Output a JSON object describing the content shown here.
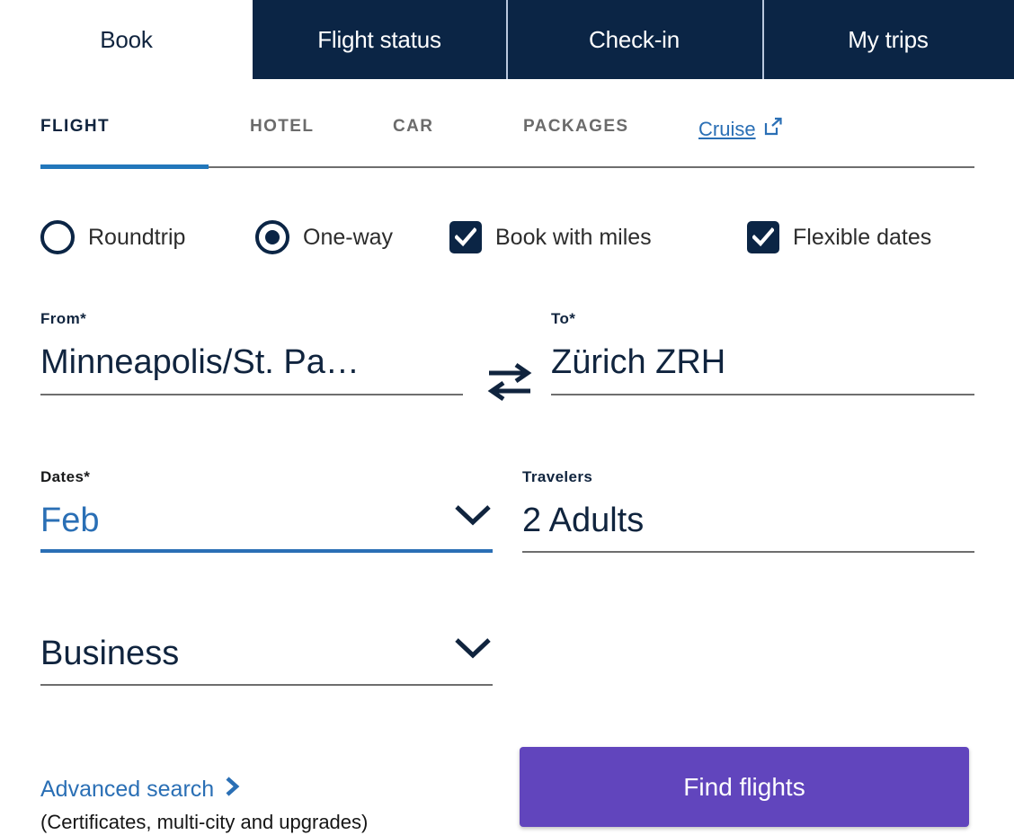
{
  "colors": {
    "navy": "#0b2545",
    "link_blue": "#2a6fb5",
    "accent_blue": "#2277bb",
    "button_purple": "#6145bd",
    "rule_gray": "#6e6e6e"
  },
  "topnav": {
    "tabs": [
      {
        "label": "Book",
        "active": true
      },
      {
        "label": "Flight status",
        "active": false
      },
      {
        "label": "Check-in",
        "active": false
      },
      {
        "label": "My trips",
        "active": false
      }
    ]
  },
  "subtabs": {
    "items": [
      {
        "label": "FLIGHT",
        "active": true
      },
      {
        "label": "HOTEL",
        "active": false
      },
      {
        "label": "CAR",
        "active": false
      },
      {
        "label": "PACKAGES",
        "active": false
      }
    ],
    "cruise": {
      "label": "Cruise",
      "icon": "external-link-icon"
    }
  },
  "trip_options": {
    "roundtrip": {
      "label": "Roundtrip",
      "selected": false
    },
    "oneway": {
      "label": "One-way",
      "selected": true
    },
    "book_with_miles": {
      "label": "Book with miles",
      "checked": true
    },
    "flexible_dates": {
      "label": "Flexible dates",
      "checked": true
    }
  },
  "search_form": {
    "from": {
      "label": "From*",
      "value": "Minneapolis/St. Pa…"
    },
    "to": {
      "label": "To*",
      "value": "Zürich ZRH"
    },
    "swap": {
      "icon": "swap-arrows-icon"
    },
    "dates": {
      "label": "Dates*",
      "value": "Feb",
      "icon": "chevron-down-icon"
    },
    "travelers": {
      "label": "Travelers",
      "value": "2 Adults"
    },
    "cabin": {
      "value": "Business",
      "icon": "chevron-down-icon"
    }
  },
  "footer": {
    "advanced_search": {
      "label": "Advanced search",
      "icon": "chevron-right-icon"
    },
    "advanced_note": "(Certificates, multi-city and upgrades)",
    "submit_label": "Find flights"
  }
}
